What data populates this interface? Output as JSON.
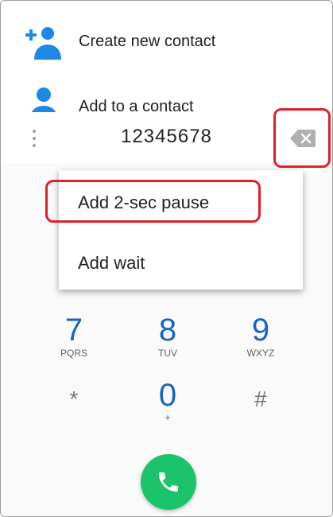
{
  "contacts_list": {
    "create_new_contact": "Create new contact",
    "add_to_contact": "Add to a contact"
  },
  "dialer": {
    "number": "12345678",
    "overflow_icon": "more-vert-icon",
    "backspace_icon": "backspace-icon"
  },
  "overflow_menu": {
    "items": [
      {
        "label": "Add 2-sec pause"
      },
      {
        "label": "Add wait"
      }
    ]
  },
  "keypad": {
    "keys": [
      {
        "digit": "7",
        "letters": "PQRS"
      },
      {
        "digit": "8",
        "letters": "TUV"
      },
      {
        "digit": "9",
        "letters": "WXYZ"
      },
      {
        "digit": "*",
        "letters": ""
      },
      {
        "digit": "0",
        "letters": "+"
      },
      {
        "digit": "#",
        "letters": ""
      }
    ]
  },
  "call_button": {
    "icon": "phone-icon"
  },
  "colors": {
    "accent_blue": "#1e88e5",
    "call_green": "#1bc46a",
    "highlight_red": "#e0202a"
  }
}
